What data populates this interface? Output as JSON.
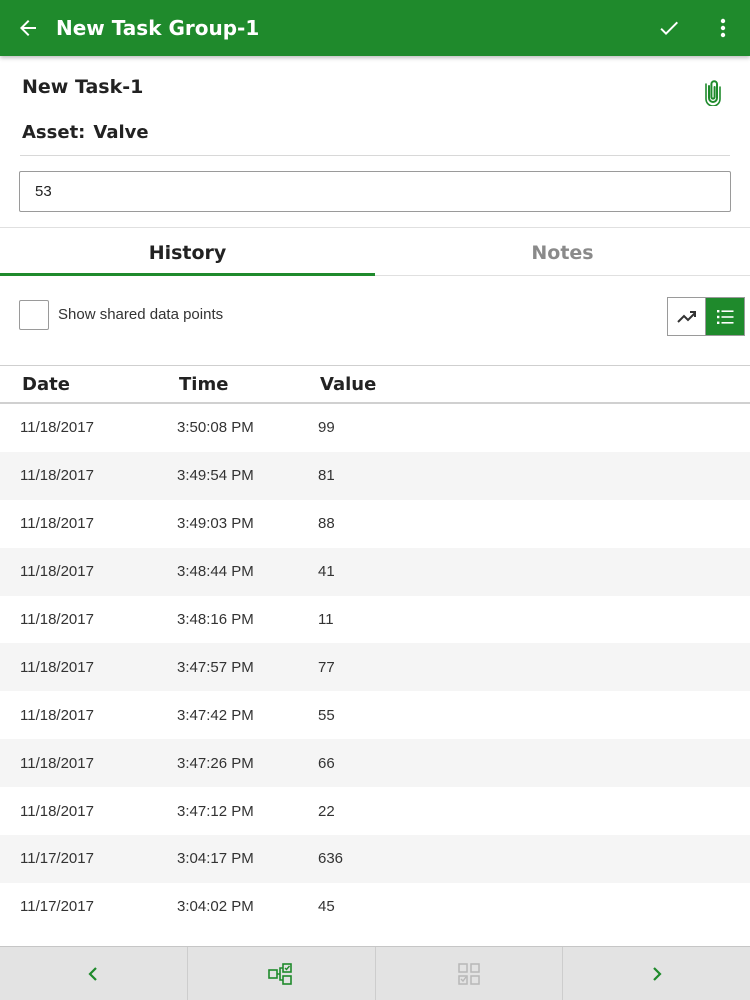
{
  "appbar": {
    "title": "New Task Group-1",
    "back_icon": "arrow-left-icon",
    "confirm_icon": "checkmark-icon",
    "menu_icon": "more-vertical-icon"
  },
  "task": {
    "name": "New Task-1",
    "asset_label": "Asset:",
    "asset_value": "Valve",
    "attachment_icon": "paperclip-icon",
    "input_value": "53"
  },
  "tabs": [
    {
      "label": "History",
      "active": true
    },
    {
      "label": "Notes",
      "active": false
    }
  ],
  "controls": {
    "show_shared_label": "Show shared data points",
    "show_shared_checked": false,
    "view_modes": [
      "chart",
      "list"
    ],
    "active_view": "list"
  },
  "table": {
    "headers": {
      "date": "Date",
      "time": "Time",
      "value": "Value"
    },
    "rows": [
      {
        "date": "11/18/2017",
        "time": "3:50:08 PM",
        "value": "99"
      },
      {
        "date": "11/18/2017",
        "time": "3:49:54 PM",
        "value": "81"
      },
      {
        "date": "11/18/2017",
        "time": "3:49:03 PM",
        "value": "88"
      },
      {
        "date": "11/18/2017",
        "time": "3:48:44 PM",
        "value": "41"
      },
      {
        "date": "11/18/2017",
        "time": "3:48:16 PM",
        "value": "11"
      },
      {
        "date": "11/18/2017",
        "time": "3:47:57 PM",
        "value": "77"
      },
      {
        "date": "11/18/2017",
        "time": "3:47:42 PM",
        "value": "55"
      },
      {
        "date": "11/18/2017",
        "time": "3:47:26 PM",
        "value": "66"
      },
      {
        "date": "11/18/2017",
        "time": "3:47:12 PM",
        "value": "22"
      },
      {
        "date": "11/17/2017",
        "time": "3:04:17 PM",
        "value": "636"
      },
      {
        "date": "11/17/2017",
        "time": "3:04:02 PM",
        "value": "45"
      }
    ]
  },
  "bottombar": {
    "buttons": [
      "chevron-left-icon",
      "task-tree-icon",
      "task-checklist-icon",
      "chevron-right-icon"
    ],
    "disabled": [
      false,
      false,
      true,
      false
    ]
  },
  "colors": {
    "brand_green": "#1f8a2c",
    "inactive_tab": "#8a8a8a",
    "bottombar_bg": "#e3e3e3"
  }
}
